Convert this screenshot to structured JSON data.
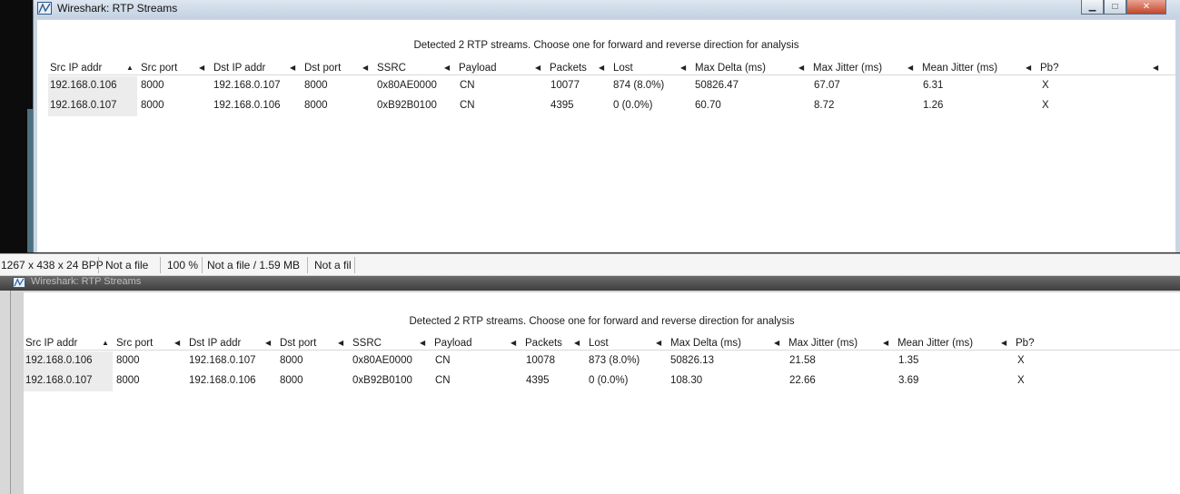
{
  "top_window": {
    "title": "Wireshark: RTP Streams",
    "heading": "Detected 2 RTP streams. Choose one for forward and reverse direction for analysis",
    "buttons": {
      "minimize": "▁",
      "maximize": "□",
      "close": "✕"
    },
    "columns": [
      "Src IP addr",
      "Src port",
      "Dst IP addr",
      "Dst port",
      "SSRC",
      "Payload",
      "Packets",
      "Lost",
      "Max Delta (ms)",
      "Max Jitter (ms)",
      "Mean Jitter (ms)",
      "Pb?"
    ],
    "rows": [
      [
        "192.168.0.106",
        "8000",
        "192.168.0.107",
        "8000",
        "0x80AE0000",
        "CN",
        "10077",
        "874 (8.0%)",
        "50826.47",
        "67.07",
        "6.31",
        "X"
      ],
      [
        "192.168.0.107",
        "8000",
        "192.168.0.106",
        "8000",
        "0xB92B0100",
        "CN",
        "4395",
        "0 (0.0%)",
        "60.70",
        "8.72",
        "1.26",
        "X"
      ]
    ]
  },
  "status_bar": {
    "dimensions": "1267 x 438 x 24 BPP",
    "file": "Not a file",
    "zoom": "100 %",
    "size": "Not a file / 1.59 MB",
    "extra": "Not a fil"
  },
  "bottom_window": {
    "title": "Wireshark: RTP Streams",
    "heading": "Detected 2 RTP streams. Choose one for forward and reverse direction for analysis",
    "columns": [
      "Src IP addr",
      "Src port",
      "Dst IP addr",
      "Dst port",
      "SSRC",
      "Payload",
      "Packets",
      "Lost",
      "Max Delta (ms)",
      "Max Jitter (ms)",
      "Mean Jitter (ms)",
      "Pb?"
    ],
    "rows": [
      [
        "192.168.0.106",
        "8000",
        "192.168.0.107",
        "8000",
        "0x80AE0000",
        "CN",
        "10078",
        "873 (8.0%)",
        "50826.13",
        "21.58",
        "1.35",
        "X"
      ],
      [
        "192.168.0.107",
        "8000",
        "192.168.0.106",
        "8000",
        "0xB92B0100",
        "CN",
        "4395",
        "0 (0.0%)",
        "108.30",
        "22.66",
        "3.69",
        "X"
      ]
    ]
  },
  "icons": {
    "app_icon": "wireshark-fin-icon",
    "sort_up": "sort-ascending-icon",
    "column_divider": "column-resize-arrow-icon"
  }
}
